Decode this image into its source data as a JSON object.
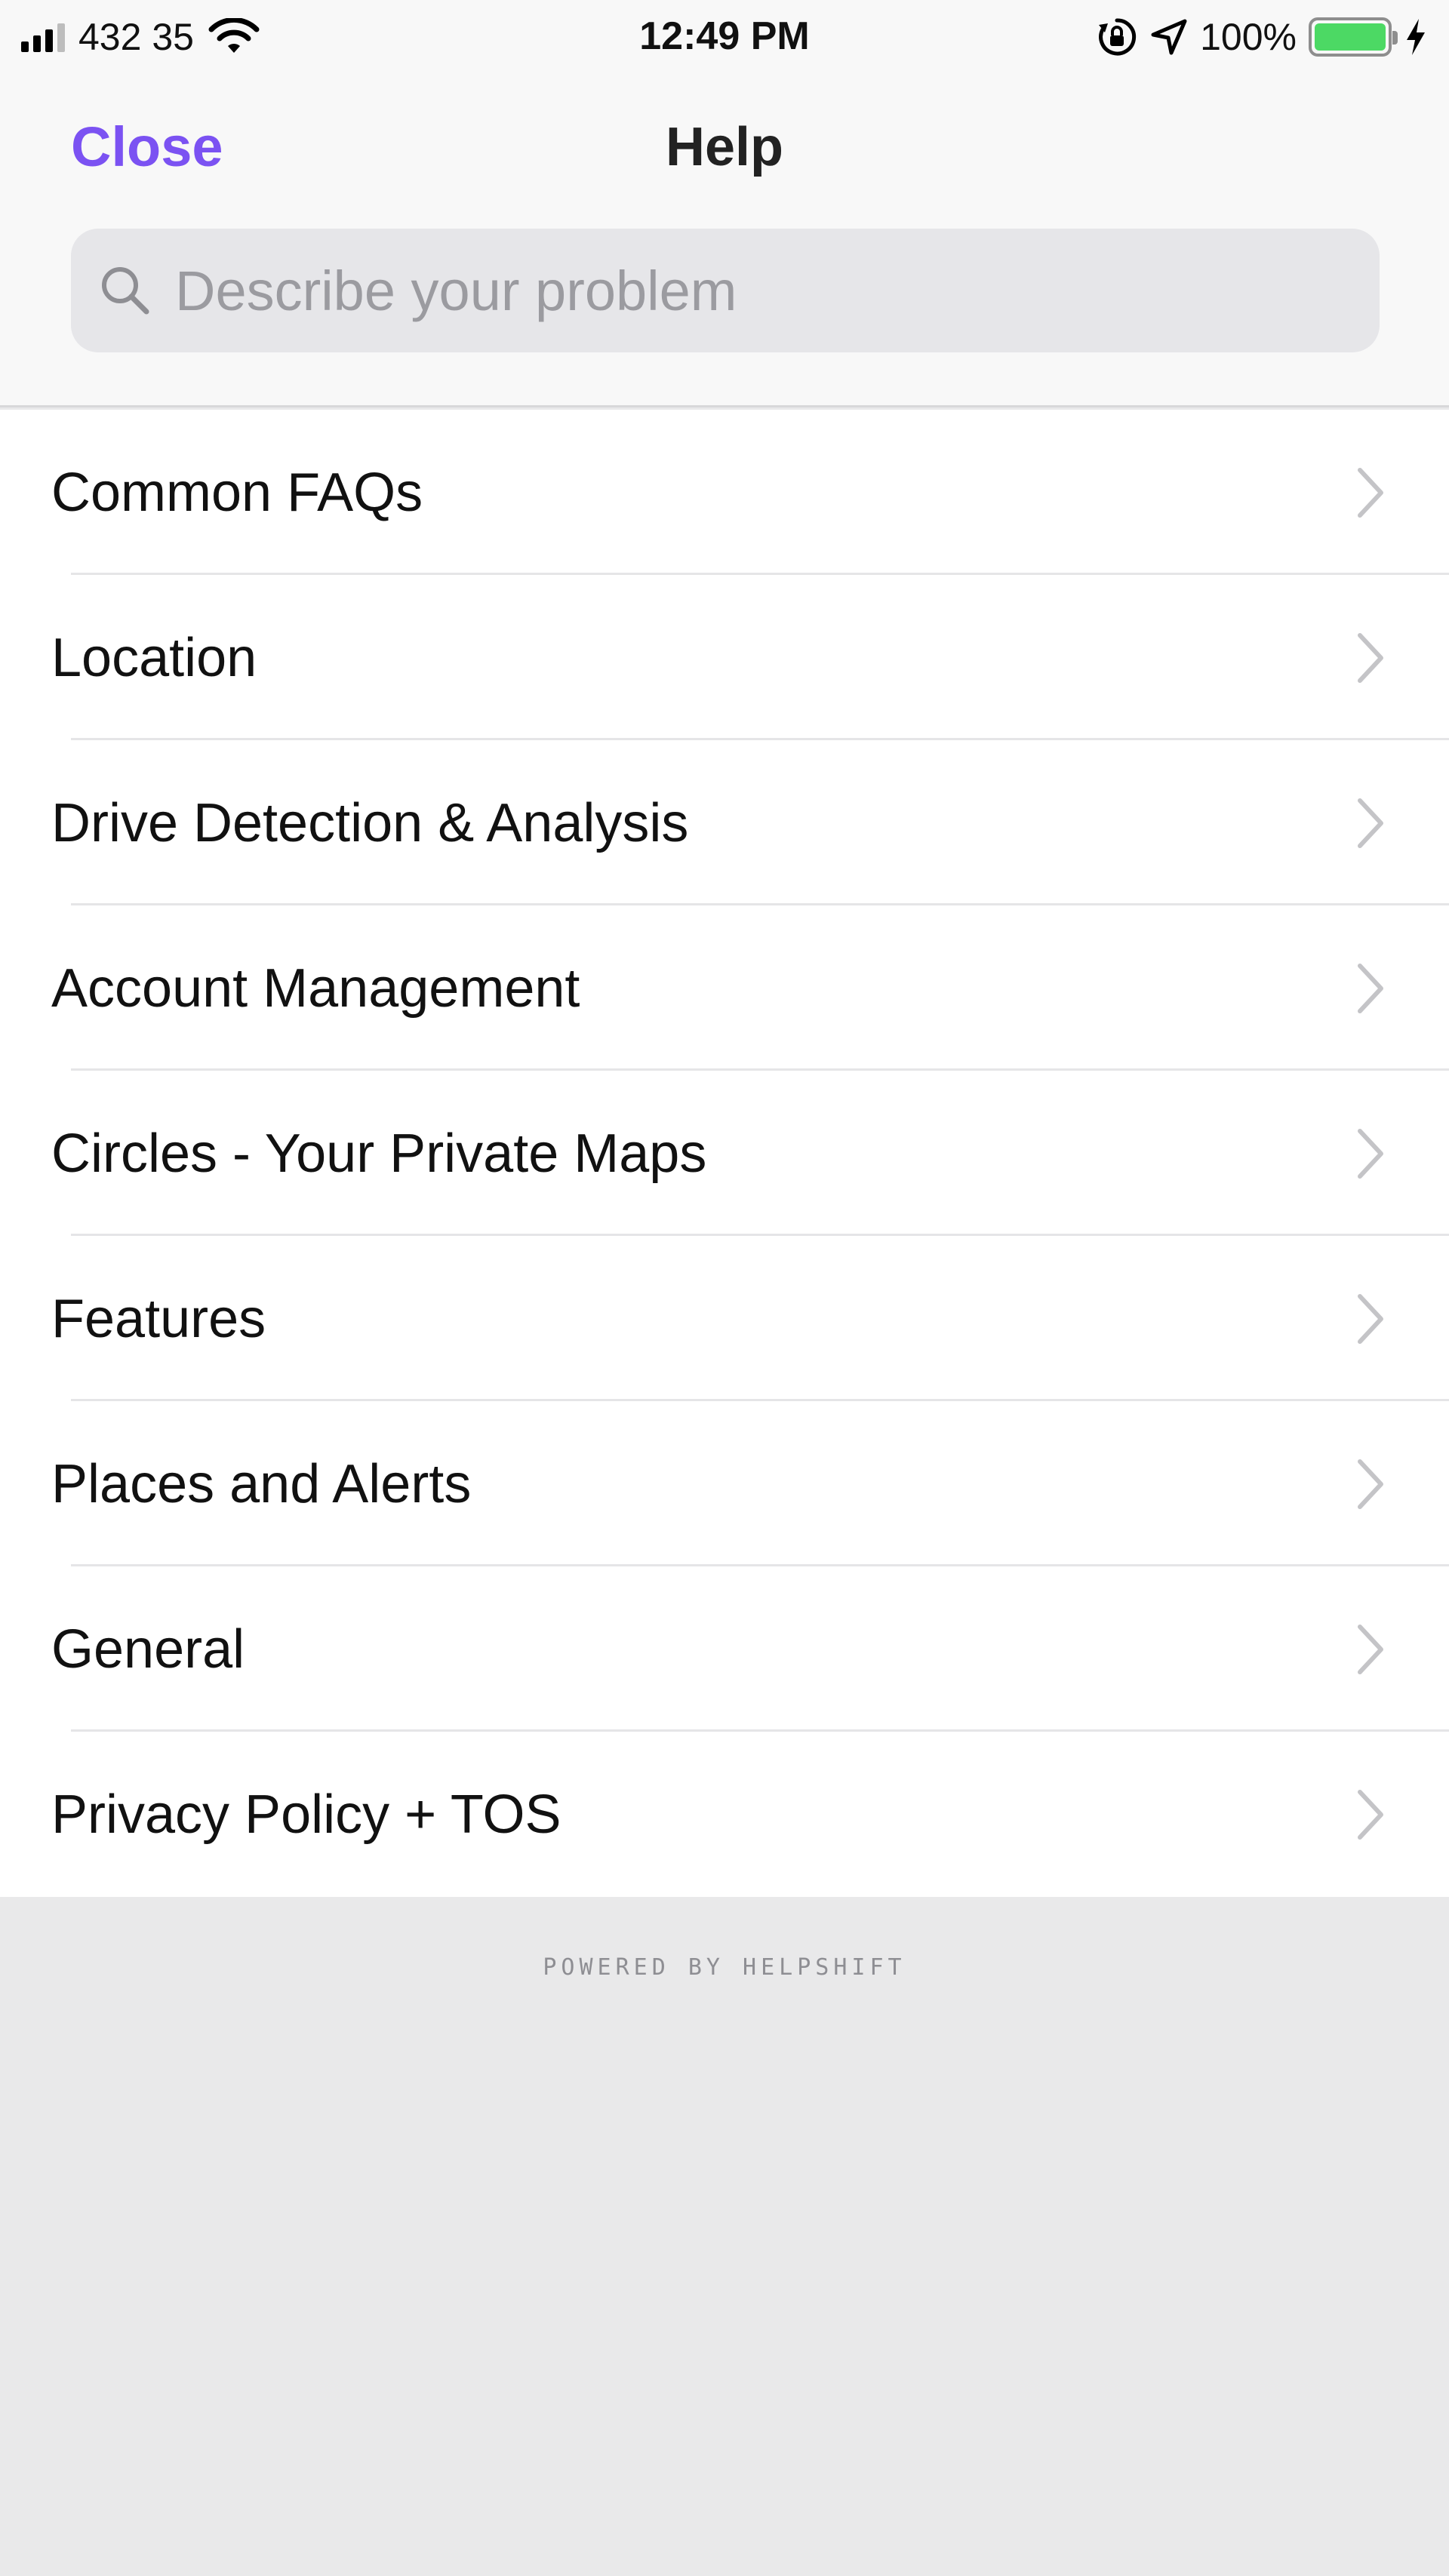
{
  "status_bar": {
    "carrier": "432 35",
    "time": "12:49 PM",
    "battery": "100%"
  },
  "nav": {
    "close_label": "Close",
    "title": "Help"
  },
  "search": {
    "placeholder": "Describe your problem",
    "value": ""
  },
  "list": {
    "items": [
      {
        "label": "Common FAQs"
      },
      {
        "label": "Location"
      },
      {
        "label": "Drive Detection & Analysis"
      },
      {
        "label": "Account Management"
      },
      {
        "label": "Circles - Your Private Maps"
      },
      {
        "label": "Features"
      },
      {
        "label": "Places and Alerts"
      },
      {
        "label": "General"
      },
      {
        "label": "Privacy Policy + TOS"
      }
    ]
  },
  "footer": {
    "powered_by": "POWERED BY HELPSHIFT"
  },
  "colors": {
    "accent": "#7b52f2",
    "battery": "#4cd964",
    "background": "#e9e9ea"
  },
  "icons": [
    "signal-icon",
    "wifi-icon",
    "rotation-lock-icon",
    "location-arrow-icon",
    "battery-icon",
    "charging-bolt-icon",
    "search-icon",
    "chevron-right-icon"
  ]
}
